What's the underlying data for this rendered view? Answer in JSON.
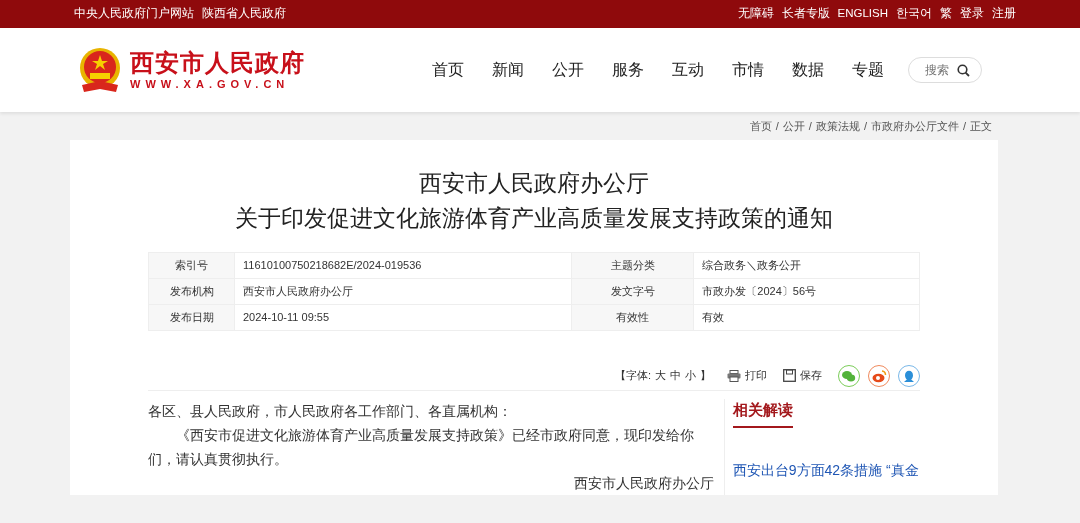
{
  "top_bar": {
    "left_links": [
      "中央人民政府门户网站",
      "陕西省人民政府"
    ],
    "right_links": [
      "无障碍",
      "长者专版",
      "ENGLISH",
      "한국어",
      "繁",
      "登录",
      "注册"
    ]
  },
  "header": {
    "logo": {
      "name": "西安市人民政府",
      "url": "WWW.XA.GOV.CN"
    },
    "nav": [
      {
        "label": "首页"
      },
      {
        "label": "新闻"
      },
      {
        "label": "公开"
      },
      {
        "label": "服务"
      },
      {
        "label": "互动"
      },
      {
        "label": "市情"
      },
      {
        "label": "数据"
      },
      {
        "label": "专题"
      }
    ],
    "search": {
      "placeholder": "搜索"
    }
  },
  "breadcrumb": {
    "separator": "/",
    "items": [
      "首页",
      "公开",
      "政策法规",
      "市政府办公厅文件",
      "正文"
    ]
  },
  "article": {
    "title_lines": [
      "西安市人民政府办公厅",
      "关于印发促进文化旅游体育产业高质量发展支持政策的通知"
    ],
    "meta": [
      {
        "label": "索引号",
        "value": "11610100750218682E/2024-019536"
      },
      {
        "label": "主题分类",
        "value": "综合政务＼政务公开"
      },
      {
        "label": "发布机构",
        "value": "西安市人民政府办公厅"
      },
      {
        "label": "发文字号",
        "value": "市政办发〔2024〕56号"
      },
      {
        "label": "发布日期",
        "value": "2024-10-11 09:55"
      },
      {
        "label": "有效性",
        "value": "有效"
      }
    ],
    "toolbar": {
      "font_label": "【字体:",
      "font_options": [
        "大",
        "中",
        "小"
      ],
      "font_close": "】",
      "print": "打印",
      "save": "保存",
      "share": [
        {
          "kind": "wechat"
        },
        {
          "kind": "weibo"
        },
        {
          "kind": "qq"
        }
      ]
    },
    "body": {
      "salutation": "各区、县人民政府，市人民政府各工作部门、各直属机构：",
      "paragraph": "《西安市促进文化旅游体育产业高质量发展支持政策》已经市政府同意，现印发给你们，请认真贯彻执行。",
      "signature": "西安市人民政府办公厅"
    }
  },
  "sidebar": {
    "title": "相关解读",
    "links": [
      "西安出台9方面42条措施 “真金"
    ]
  }
}
